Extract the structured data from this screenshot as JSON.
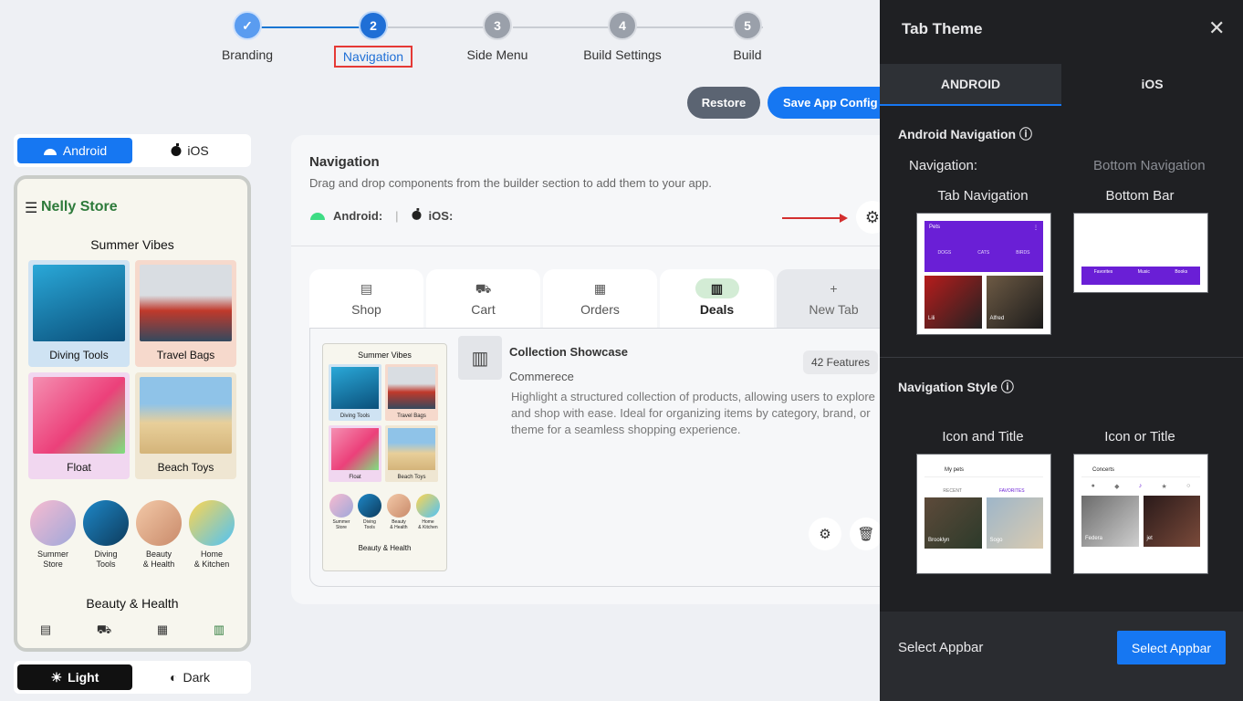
{
  "stepper": {
    "steps": [
      {
        "number": "✓",
        "label": "Branding"
      },
      {
        "number": "2",
        "label": "Navigation"
      },
      {
        "number": "3",
        "label": "Side Menu"
      },
      {
        "number": "4",
        "label": "Build Settings"
      },
      {
        "number": "5",
        "label": "Build"
      }
    ]
  },
  "actions": {
    "restore": "Restore",
    "save": "Save App Config"
  },
  "preview": {
    "os_toggle": {
      "android": "Android",
      "ios": "iOS"
    },
    "store_name": "Nelly Store",
    "section1": "Summer Vibes",
    "tiles": [
      "Diving Tools",
      "Travel Bags",
      "Float",
      "Beach Toys"
    ],
    "circles": [
      {
        "l1": "Summer",
        "l2": "Store"
      },
      {
        "l1": "Diving",
        "l2": "Tools"
      },
      {
        "l1": "Beauty",
        "l2": "& Health"
      },
      {
        "l1": "Home",
        "l2": "& Kitchen"
      }
    ],
    "section2": "Beauty & Health",
    "theme": {
      "light": "Light",
      "dark": "Dark"
    }
  },
  "navigation": {
    "title": "Navigation",
    "description": "Drag and drop components from the builder section to add them to your app.",
    "android_label": "Android:",
    "separator": "|",
    "ios_label": "iOS:",
    "tabs": [
      "Shop",
      "Cart",
      "Orders",
      "Deals",
      "New Tab"
    ],
    "component": {
      "title": "Collection Showcase",
      "subtitle": "Commerece",
      "description": "Highlight a structured collection of products, allowing users to explore and shop with ease. Ideal for organizing items by category, brand, or theme for a seamless shopping experience.",
      "badge": "42 Features"
    },
    "mini": {
      "heading": "Summer Vibes",
      "tiles": [
        "Diving Tools",
        "Travel Bags",
        "Float",
        "Beach Toys"
      ],
      "circles": [
        {
          "l1": "Summer",
          "l2": "Store"
        },
        {
          "l1": "Diving",
          "l2": "Tools"
        },
        {
          "l1": "Beauty",
          "l2": "& Health"
        },
        {
          "l1": "Home",
          "l2": "& Kitchen"
        }
      ],
      "footer": "Beauty & Health"
    }
  },
  "drawer": {
    "title": "Tab Theme",
    "tabs": {
      "android": "ANDROID",
      "ios": "iOS"
    },
    "android_nav": "Android Navigation",
    "nav_label": "Navigation:",
    "nav_value": "Bottom Navigation",
    "option_tab": "Tab Navigation",
    "option_bottom": "Bottom Bar",
    "tab_preview": {
      "title": "Pets",
      "tabs": [
        "DOGS",
        "CATS",
        "BIRDS"
      ],
      "captions": [
        "Lili",
        "Alfred"
      ]
    },
    "bottom_preview": {
      "items": [
        "Favorites",
        "Music",
        "Books"
      ]
    },
    "nav_style": "Navigation Style",
    "style_icon_title": "Icon and Title",
    "style_icon_or": "Icon or Title",
    "style1_preview": {
      "title": "My pets",
      "tabs": [
        "RECENT",
        "FAVORITES"
      ],
      "captions": [
        "Brooklyn",
        "Sogo"
      ]
    },
    "style2_preview": {
      "title": "Concerts",
      "captions": [
        "Federa",
        "jet"
      ]
    },
    "appbar_label": "Select Appbar",
    "appbar_button": "Select Appbar"
  }
}
